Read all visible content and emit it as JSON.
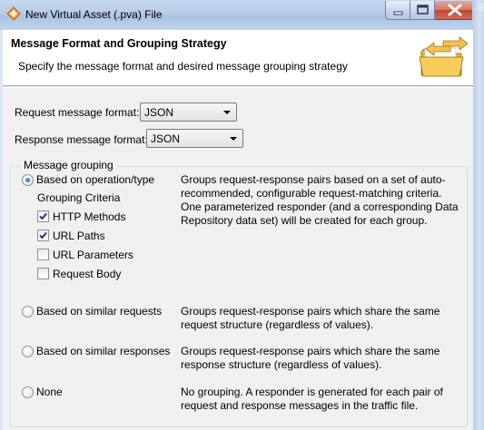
{
  "window": {
    "title": "New Virtual Asset (.pva) File",
    "buttons": {
      "minimize": "minimize",
      "maximize": "maximize",
      "close": "close"
    }
  },
  "header": {
    "title": "Message Format and Grouping Strategy",
    "description": "Specify the message format and desired message grouping strategy",
    "icon": "folder-arrows-icon"
  },
  "request_format": {
    "label": "Request message format:",
    "value": "JSON"
  },
  "response_format": {
    "label": "Response message format:",
    "value": "JSON"
  },
  "grouping": {
    "legend": "Message grouping",
    "criteria_label": "Grouping Criteria",
    "criteria": [
      {
        "label": "HTTP Methods",
        "checked": true
      },
      {
        "label": "URL Paths",
        "checked": true
      },
      {
        "label": "URL Parameters",
        "checked": false
      },
      {
        "label": "Request Body",
        "checked": false
      }
    ],
    "options": [
      {
        "label": "Based on operation/type",
        "selected": true,
        "desc": [
          "Groups request-response pairs based on a set of auto-",
          "recommended, configurable request-matching criteria.",
          "One parameterized responder (and a corresponding Data",
          "Repository data set) will be created for each group."
        ]
      },
      {
        "label": "Based on similar requests",
        "selected": false,
        "desc": [
          "Groups request-response pairs which share the same",
          "request structure (regardless of values)."
        ]
      },
      {
        "label": "Based on similar responses",
        "selected": false,
        "desc": [
          "Groups request-response pairs which share the same",
          "response structure (regardless of values)."
        ]
      },
      {
        "label": "None",
        "selected": false,
        "desc": [
          "No grouping. A responder is generated for each pair of",
          "request and response messages in the traffic file."
        ]
      }
    ]
  }
}
